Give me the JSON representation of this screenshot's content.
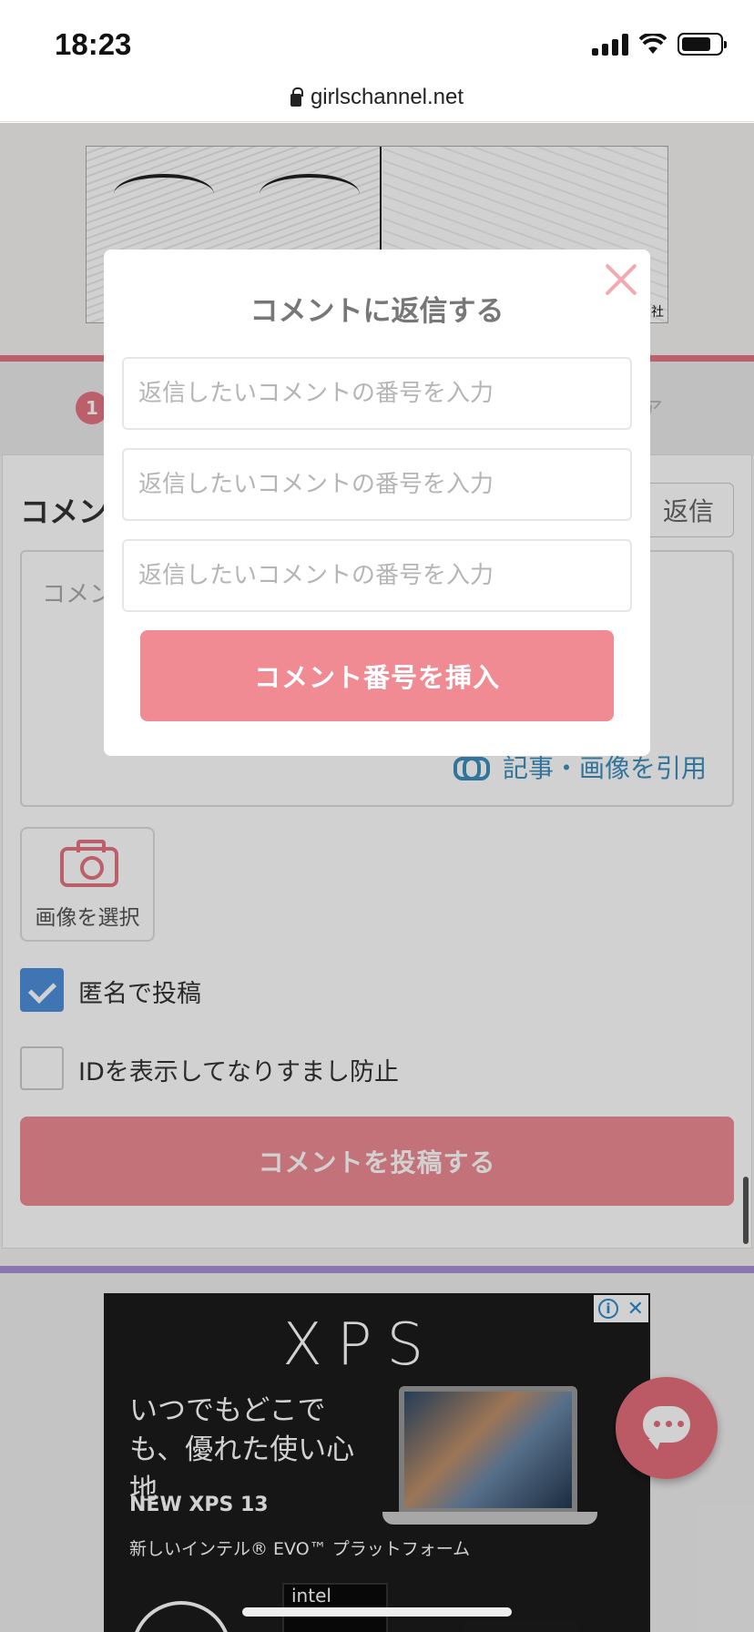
{
  "status_bar": {
    "time": "18:23"
  },
  "browser": {
    "url": "girlschannel.net"
  },
  "banner": {
    "credit": "社"
  },
  "tabs": {
    "badge": "1",
    "right_text": "ア"
  },
  "comment_form": {
    "title": "コメン",
    "reply_label": "返信",
    "comment_placeholder": "コメン",
    "quote_link": "記事・画像を引用",
    "image_button": "画像を選択",
    "anonymous_label": "匿名で投稿",
    "anonymous_checked": true,
    "show_id_label": "IDを表示してなりすまし防止",
    "show_id_checked": false,
    "submit_label": "コメントを投稿する"
  },
  "ad": {
    "logo": "XPS",
    "headline": "いつでもどこでも、優れた使い心地",
    "product": "NEW XPS 13",
    "tagline": "新しいインテル® EVO™ プラットフォーム",
    "badge": "intel"
  },
  "modal": {
    "title": "コメントに返信する",
    "inputs": [
      {
        "placeholder": "返信したいコメントの番号を入力",
        "value": ""
      },
      {
        "placeholder": "返信したいコメントの番号を入力",
        "value": ""
      },
      {
        "placeholder": "返信したいコメントの番号を入力",
        "value": ""
      }
    ],
    "insert_button": "コメント番号を挿入"
  },
  "colors": {
    "accent_pink": "#f08b94",
    "link_blue": "#3e8fbe",
    "checkbox_blue": "#4d8fdb",
    "divider_purple": "#a88fd6"
  },
  "icons": [
    "lock-icon",
    "camera-icon",
    "link-icon",
    "checkmark-icon",
    "close-icon",
    "chat-icon",
    "info-icon"
  ]
}
